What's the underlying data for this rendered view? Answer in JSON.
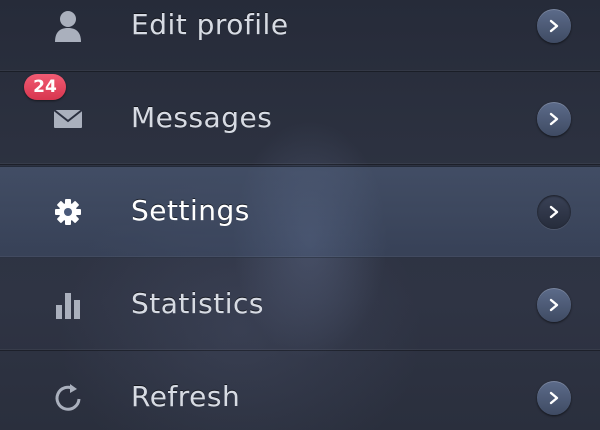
{
  "menu": {
    "items": [
      {
        "label": "Edit profile",
        "icon": "user-icon",
        "active": false
      },
      {
        "label": "Messages",
        "icon": "envelope-icon",
        "badge": "24",
        "active": false
      },
      {
        "label": "Settings",
        "icon": "gear-icon",
        "active": true
      },
      {
        "label": "Statistics",
        "icon": "bar-chart-icon",
        "active": false
      },
      {
        "label": "Refresh",
        "icon": "refresh-icon",
        "active": false
      }
    ],
    "chevron_icon": "chevron-right-icon"
  },
  "colors": {
    "background": "#2a2f3d",
    "active_row": "#4b5c7d",
    "badge": "#e8475f",
    "text": "#d7dbe3",
    "chevron_button": "#4e5b77"
  }
}
